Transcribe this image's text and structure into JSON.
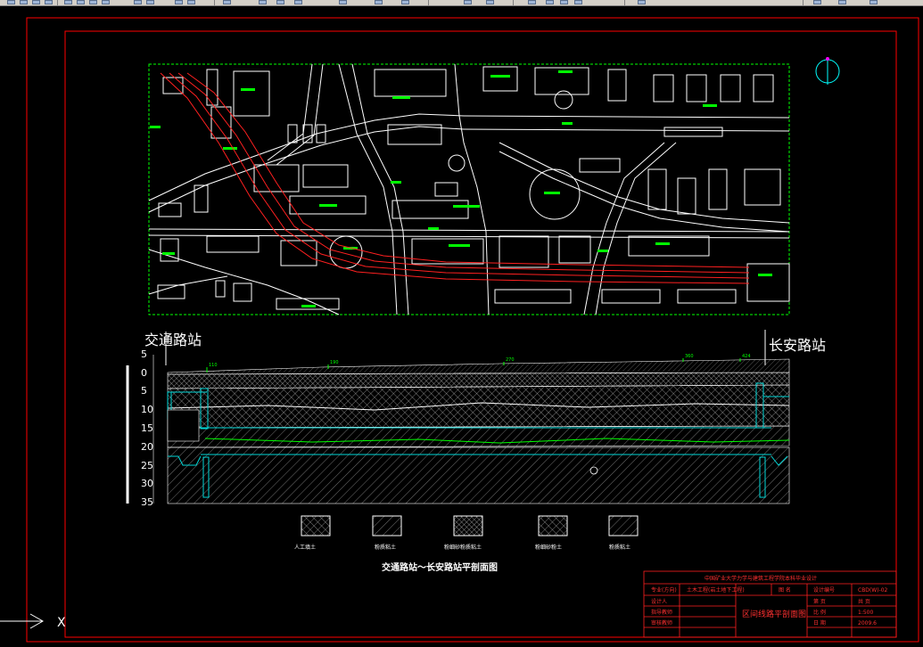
{
  "station_left": "交通路站",
  "station_right": "长安路站",
  "depth_axis": {
    "ticks": [
      "5",
      "0",
      "5",
      "10",
      "15",
      "20",
      "25",
      "30",
      "35"
    ]
  },
  "chainage_labels": [
    "110",
    "190",
    "270",
    "360",
    "424"
  ],
  "legend": [
    {
      "label": "人工填土"
    },
    {
      "label": "粉质粘土"
    },
    {
      "label": "粉细砂粉质粘土"
    },
    {
      "label": "粉细砂粉土"
    },
    {
      "label": "粉质粘土"
    }
  ],
  "drawing_title": "交通路站～长安路站平剖面图",
  "title_block": {
    "header": "中国矿业大学力学与建筑工程学院本科毕业设计",
    "rows": [
      {
        "c1": "专业(方向)",
        "c2": "土木工程(岩土地下工程)",
        "c3": "图  名",
        "c4": "设计编号",
        "c5": "CBD(W)-02"
      },
      {
        "c1": "设计人",
        "c2": "",
        "c3": "",
        "c4": "第 页",
        "c5": "共 页"
      },
      {
        "c1": "指导教师",
        "c2": "",
        "c3": "",
        "c4": "比 例",
        "c5": "1:500"
      },
      {
        "c1": "审核教师",
        "c2": "",
        "c3": "",
        "c4": "日 期",
        "c5": "2009.6"
      }
    ],
    "name": "区间线路平剖面图"
  },
  "ucs_label": "X",
  "colors": {
    "background": "#000000",
    "frame": "#ff0000",
    "plan_border": "#00ff00",
    "tunnel": "#ff2020",
    "water": "#00d8d8",
    "lines": "#ffffff"
  }
}
